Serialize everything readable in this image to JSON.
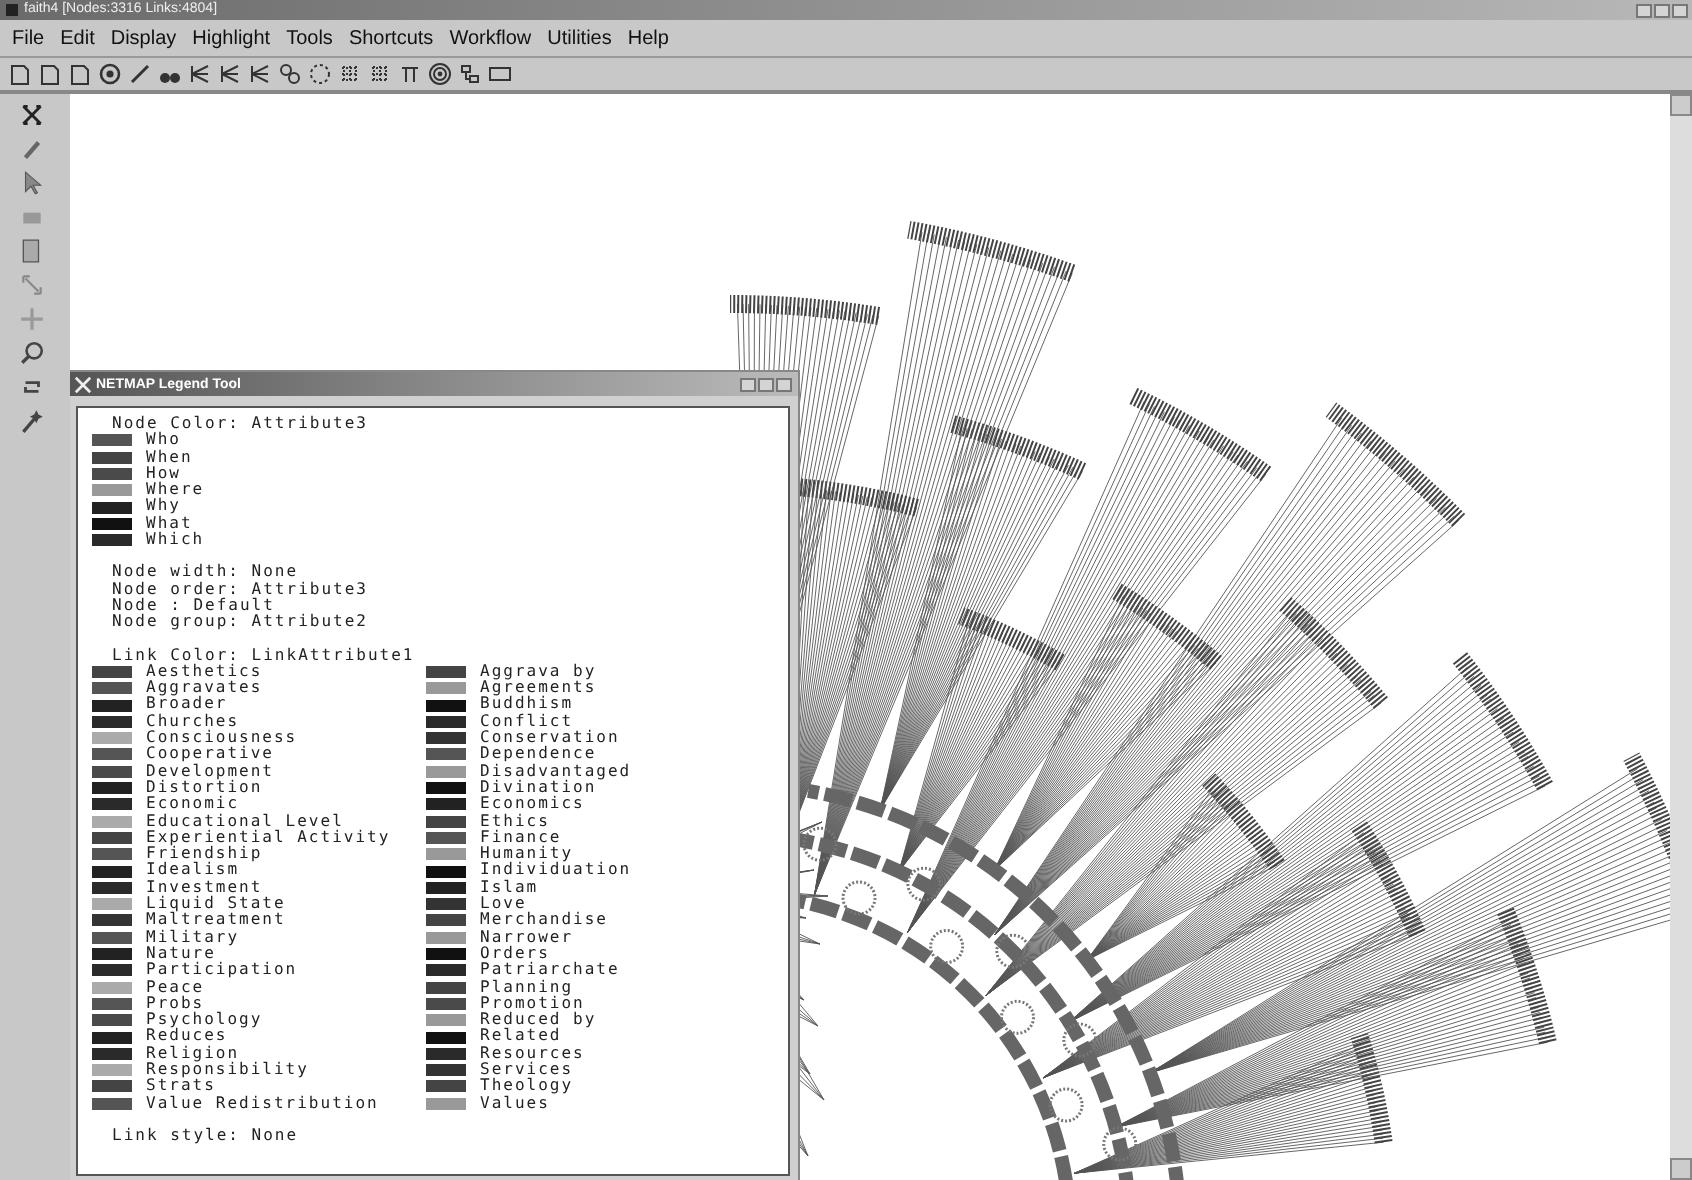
{
  "window": {
    "title": "faith4 [Nodes:3316 Links:4804]"
  },
  "menu": [
    "File",
    "Edit",
    "Display",
    "Highlight",
    "Tools",
    "Shortcuts",
    "Workflow",
    "Utilities",
    "Help"
  ],
  "legend_window": {
    "title": "NETMAP Legend Tool",
    "node_color_heading": "Node Color: Attribute3",
    "node_colors": [
      {
        "label": "Who",
        "color": "#555555"
      },
      {
        "label": "When",
        "color": "#444444"
      },
      {
        "label": "How",
        "color": "#4a4a4a"
      },
      {
        "label": "Where",
        "color": "#999999"
      },
      {
        "label": "Why",
        "color": "#222222"
      },
      {
        "label": "What",
        "color": "#111111"
      },
      {
        "label": "Which",
        "color": "#2a2a2a"
      }
    ],
    "node_settings": [
      "Node width: None",
      "Node order: Attribute3",
      "Node : Default",
      "Node group: Attribute2"
    ],
    "link_color_heading": "Link Color: LinkAttribute1",
    "link_color_columns": [
      [
        {
          "label": "Aesthetics",
          "color": "#444444"
        },
        {
          "label": "Aggravates",
          "color": "#555555"
        },
        {
          "label": "Broader",
          "color": "#222222"
        },
        {
          "label": "Churches",
          "color": "#2a2a2a"
        },
        {
          "label": "Consciousness",
          "color": "#aaaaaa"
        },
        {
          "label": "Cooperative",
          "color": "#555555"
        },
        {
          "label": "Development",
          "color": "#4a4a4a"
        },
        {
          "label": "Distortion",
          "color": "#222222"
        },
        {
          "label": "Economic",
          "color": "#2a2a2a"
        },
        {
          "label": "Educational Level",
          "color": "#aaaaaa"
        },
        {
          "label": "Experiential Activity",
          "color": "#444444"
        },
        {
          "label": "Friendship",
          "color": "#555555"
        },
        {
          "label": "Idealism",
          "color": "#222222"
        },
        {
          "label": "Investment",
          "color": "#2a2a2a"
        },
        {
          "label": "Liquid State",
          "color": "#aaaaaa"
        },
        {
          "label": "Maltreatment",
          "color": "#333333"
        },
        {
          "label": "Military",
          "color": "#555555"
        },
        {
          "label": "Nature",
          "color": "#222222"
        },
        {
          "label": "Participation",
          "color": "#2a2a2a"
        },
        {
          "label": "Peace",
          "color": "#aaaaaa"
        },
        {
          "label": "Probs",
          "color": "#555555"
        },
        {
          "label": "Psychology",
          "color": "#4a4a4a"
        },
        {
          "label": "Reduces",
          "color": "#222222"
        },
        {
          "label": "Religion",
          "color": "#2a2a2a"
        },
        {
          "label": "Responsibility",
          "color": "#aaaaaa"
        },
        {
          "label": "Strats",
          "color": "#444444"
        },
        {
          "label": "Value Redistribution",
          "color": "#555555"
        }
      ],
      [
        {
          "label": "Aggrava by",
          "color": "#444444"
        },
        {
          "label": "Agreements",
          "color": "#999999"
        },
        {
          "label": "Buddhism",
          "color": "#111111"
        },
        {
          "label": "Conflict",
          "color": "#2a2a2a"
        },
        {
          "label": "Conservation",
          "color": "#333333"
        },
        {
          "label": "Dependence",
          "color": "#555555"
        },
        {
          "label": "Disadvantaged",
          "color": "#999999"
        },
        {
          "label": "Divination",
          "color": "#111111"
        },
        {
          "label": "Economics",
          "color": "#222222"
        },
        {
          "label": "Ethics",
          "color": "#444444"
        },
        {
          "label": "Finance",
          "color": "#555555"
        },
        {
          "label": "Humanity",
          "color": "#999999"
        },
        {
          "label": "Individuation",
          "color": "#111111"
        },
        {
          "label": "Islam",
          "color": "#222222"
        },
        {
          "label": "Love",
          "color": "#333333"
        },
        {
          "label": "Merchandise",
          "color": "#444444"
        },
        {
          "label": "Narrower",
          "color": "#999999"
        },
        {
          "label": "Orders",
          "color": "#111111"
        },
        {
          "label": "Patriarchate",
          "color": "#2a2a2a"
        },
        {
          "label": "Planning",
          "color": "#444444"
        },
        {
          "label": "Promotion",
          "color": "#4a4a4a"
        },
        {
          "label": "Reduced by",
          "color": "#999999"
        },
        {
          "label": "Related",
          "color": "#111111"
        },
        {
          "label": "Resources",
          "color": "#2a2a2a"
        },
        {
          "label": "Services",
          "color": "#333333"
        },
        {
          "label": "Theology",
          "color": "#444444"
        },
        {
          "label": "Values",
          "color": "#999999"
        }
      ]
    ],
    "link_style": "Link style: None"
  }
}
